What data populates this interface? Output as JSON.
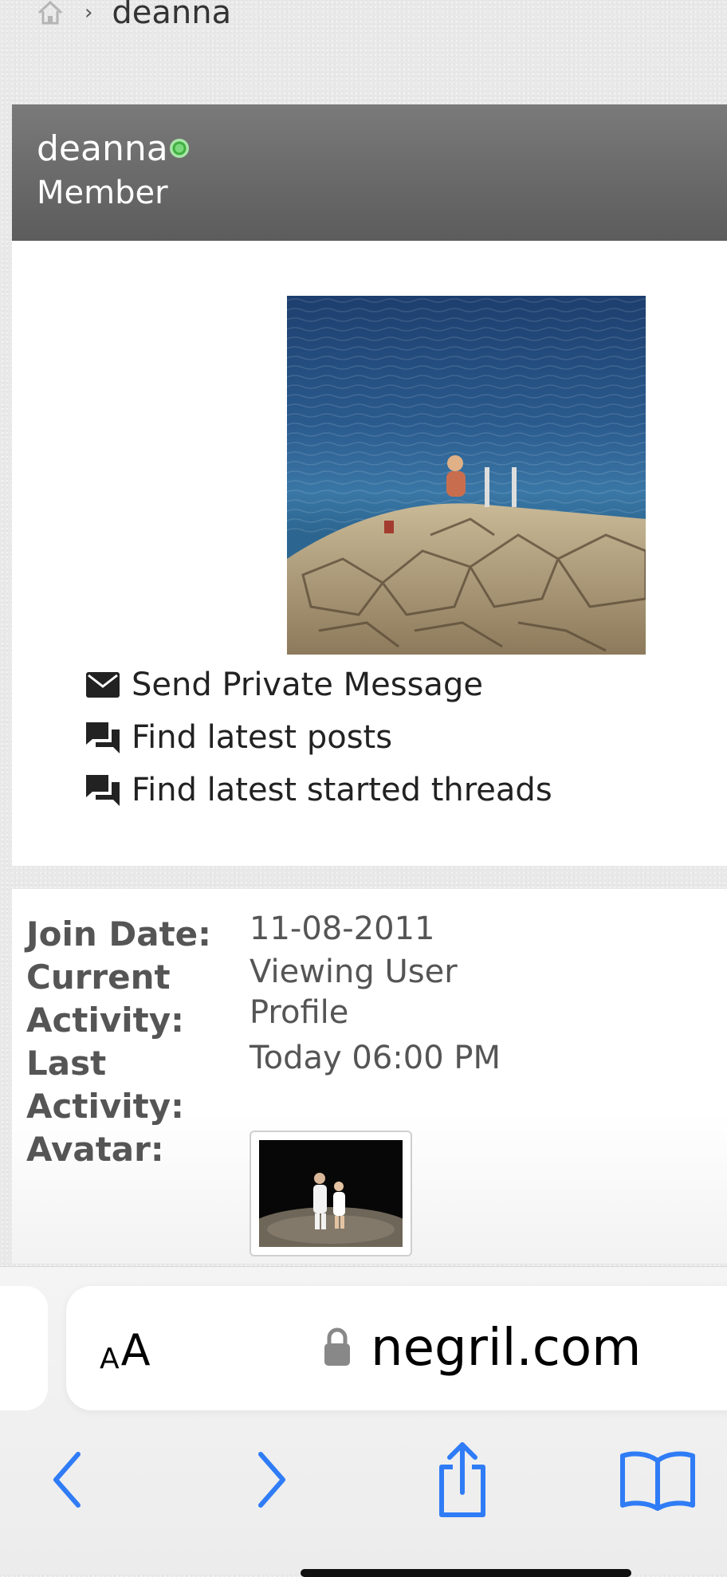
{
  "breadcrumb": {
    "current": "deanna",
    "separator": "›"
  },
  "profile": {
    "username": "deanna",
    "usertitle": "Member"
  },
  "actions": [
    {
      "label": "Send Private Message",
      "icon": "envelope-icon"
    },
    {
      "label": "Find latest posts",
      "icon": "chat-bubbles-icon"
    },
    {
      "label": "Find latest started threads",
      "icon": "chat-bubbles-icon"
    }
  ],
  "info": {
    "join_date_label": "Join Date:",
    "join_date_value": "11-08-2011",
    "current_activity_label_1": "Current",
    "current_activity_label_2": "Activity:",
    "current_activity_value_1": "Viewing User",
    "current_activity_value_2": "Profile",
    "last_activity_label_1": "Last",
    "last_activity_label_2": "Activity:",
    "last_activity_value": "Today 06:00 PM",
    "avatar_label": "Avatar:"
  },
  "browser": {
    "text_size_small": "A",
    "text_size_big": "A",
    "domain": "negril.com"
  },
  "colors": {
    "header_bg": "#6b6b6b",
    "ios_blue": "#2f7cf6",
    "online_green": "#4cbf4c"
  }
}
